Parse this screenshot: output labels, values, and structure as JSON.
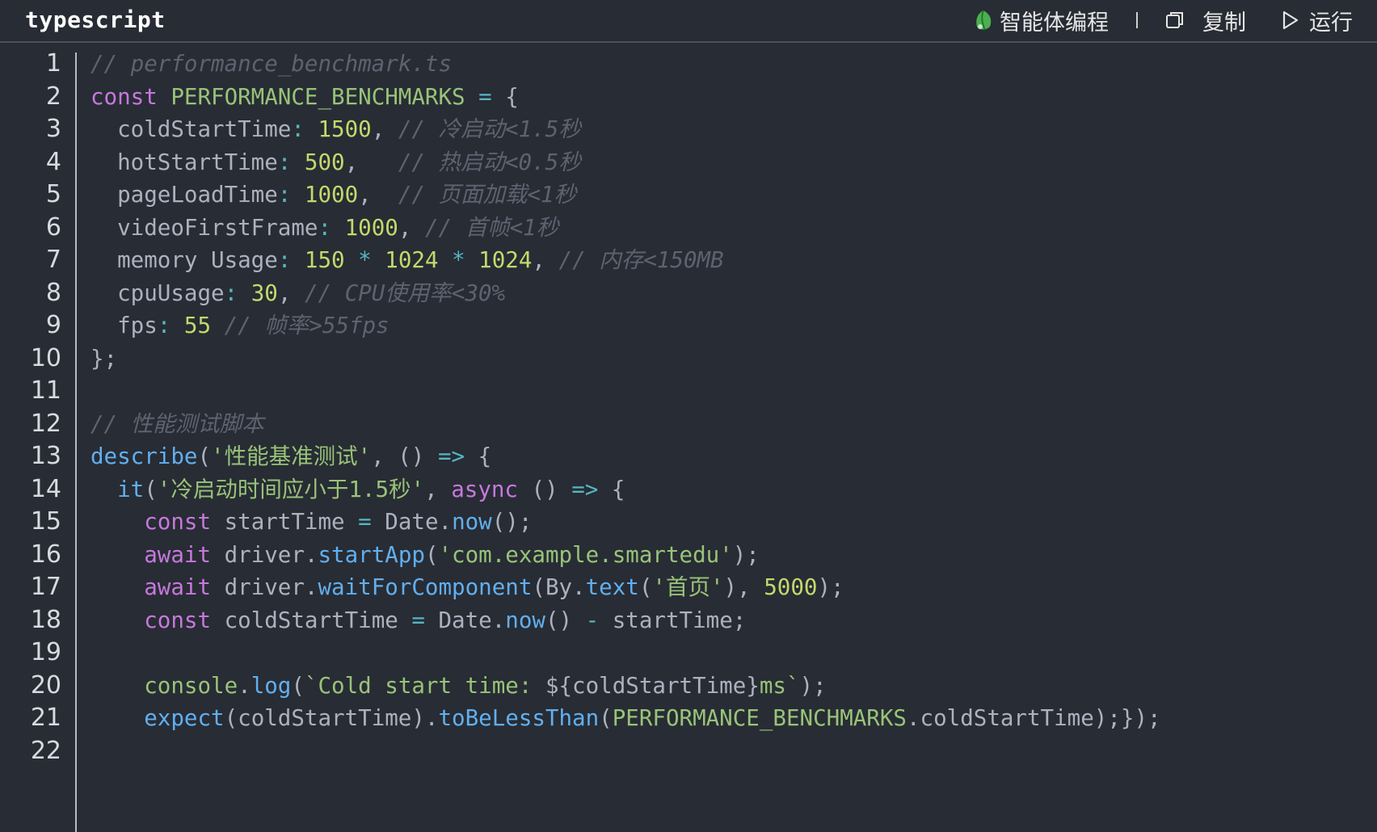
{
  "header": {
    "language": "typescript",
    "agent_label": "智能体编程",
    "copy_label": "复制",
    "run_label": "运行"
  },
  "colors": {
    "background": "#282c34",
    "keyword": "#c678dd",
    "string": "#98c379",
    "number": "#c5d86d",
    "comment": "#5c6370",
    "function": "#61afef",
    "agent_icon": "#4caf50"
  },
  "lines": [
    {
      "n": "1",
      "tokens": [
        [
          "cm",
          "// performance_benchmark.ts"
        ]
      ]
    },
    {
      "n": "2",
      "tokens": [
        [
          "kw",
          "const "
        ],
        [
          "cn",
          "PERFORMANCE_BENCHMARKS"
        ],
        [
          "op",
          " = "
        ],
        [
          "pl",
          "{"
        ]
      ]
    },
    {
      "n": "3",
      "tokens": [
        [
          "pr",
          "  coldStartTime"
        ],
        [
          "op",
          ": "
        ],
        [
          "num",
          "1500"
        ],
        [
          "pl",
          ", "
        ],
        [
          "cm",
          "// 冷启动<1.5秒"
        ]
      ]
    },
    {
      "n": "4",
      "tokens": [
        [
          "pr",
          "  hotStartTime"
        ],
        [
          "op",
          ": "
        ],
        [
          "num",
          "500"
        ],
        [
          "pl",
          ",   "
        ],
        [
          "cm",
          "// 热启动<0.5秒"
        ]
      ]
    },
    {
      "n": "5",
      "tokens": [
        [
          "pr",
          "  pageLoadTime"
        ],
        [
          "op",
          ": "
        ],
        [
          "num",
          "1000"
        ],
        [
          "pl",
          ",  "
        ],
        [
          "cm",
          "// 页面加载<1秒"
        ]
      ]
    },
    {
      "n": "6",
      "tokens": [
        [
          "pr",
          "  videoFirstFrame"
        ],
        [
          "op",
          ": "
        ],
        [
          "num",
          "1000"
        ],
        [
          "pl",
          ", "
        ],
        [
          "cm",
          "// 首帧<1秒"
        ]
      ]
    },
    {
      "n": "7",
      "tokens": [
        [
          "pr",
          "  memory Usage"
        ],
        [
          "op",
          ": "
        ],
        [
          "num",
          "150"
        ],
        [
          "op",
          " * "
        ],
        [
          "num",
          "1024"
        ],
        [
          "op",
          " * "
        ],
        [
          "num",
          "1024"
        ],
        [
          "pl",
          ", "
        ],
        [
          "cm",
          "// 内存<150MB"
        ]
      ]
    },
    {
      "n": "8",
      "tokens": [
        [
          "pr",
          "  cpuUsage"
        ],
        [
          "op",
          ": "
        ],
        [
          "num",
          "30"
        ],
        [
          "pl",
          ", "
        ],
        [
          "cm",
          "// CPU使用率<30%"
        ]
      ]
    },
    {
      "n": "9",
      "tokens": [
        [
          "pr",
          "  fps"
        ],
        [
          "op",
          ": "
        ],
        [
          "num",
          "55"
        ],
        [
          "pl",
          " "
        ],
        [
          "cm",
          "// 帧率>55fps"
        ]
      ]
    },
    {
      "n": "10",
      "tokens": [
        [
          "pl",
          "};"
        ]
      ]
    },
    {
      "n": "11",
      "tokens": []
    },
    {
      "n": "12",
      "tokens": [
        [
          "cm",
          "// 性能测试脚本"
        ]
      ]
    },
    {
      "n": "13",
      "tokens": [
        [
          "fn",
          "describe"
        ],
        [
          "pl",
          "("
        ],
        [
          "str",
          "'性能基准测试'"
        ],
        [
          "pl",
          ", () "
        ],
        [
          "op",
          "=>"
        ],
        [
          "pl",
          " {"
        ]
      ]
    },
    {
      "n": "14",
      "tokens": [
        [
          "fn",
          "  it"
        ],
        [
          "pl",
          "("
        ],
        [
          "str",
          "'冷启动时间应小于1.5秒'"
        ],
        [
          "pl",
          ", "
        ],
        [
          "kw",
          "async"
        ],
        [
          "pl",
          " () "
        ],
        [
          "op",
          "=>"
        ],
        [
          "pl",
          " {"
        ]
      ]
    },
    {
      "n": "15",
      "tokens": [
        [
          "kw",
          "    const "
        ],
        [
          "pl",
          "startTime "
        ],
        [
          "op",
          "="
        ],
        [
          "pl",
          " Date."
        ],
        [
          "fn",
          "now"
        ],
        [
          "pl",
          "();"
        ]
      ]
    },
    {
      "n": "16",
      "tokens": [
        [
          "kw",
          "    await "
        ],
        [
          "pl",
          "driver."
        ],
        [
          "fn",
          "startApp"
        ],
        [
          "pl",
          "("
        ],
        [
          "str",
          "'com.example.smartedu'"
        ],
        [
          "pl",
          ");"
        ]
      ]
    },
    {
      "n": "17",
      "tokens": [
        [
          "kw",
          "    await "
        ],
        [
          "pl",
          "driver."
        ],
        [
          "fn",
          "waitForComponent"
        ],
        [
          "pl",
          "(By."
        ],
        [
          "fn",
          "text"
        ],
        [
          "pl",
          "("
        ],
        [
          "str",
          "'首页'"
        ],
        [
          "pl",
          "), "
        ],
        [
          "num",
          "5000"
        ],
        [
          "pl",
          ");"
        ]
      ]
    },
    {
      "n": "18",
      "tokens": [
        [
          "kw",
          "    const "
        ],
        [
          "pl",
          "coldStartTime "
        ],
        [
          "op",
          "="
        ],
        [
          "pl",
          " Date."
        ],
        [
          "fn",
          "now"
        ],
        [
          "pl",
          "() "
        ],
        [
          "op",
          "-"
        ],
        [
          "pl",
          " startTime;"
        ]
      ]
    },
    {
      "n": "19",
      "tokens": []
    },
    {
      "n": "20",
      "tokens": [
        [
          "cn",
          "    console"
        ],
        [
          "pl",
          "."
        ],
        [
          "fn",
          "log"
        ],
        [
          "pl",
          "("
        ],
        [
          "str",
          "`Cold start time: "
        ],
        [
          "pl",
          "${coldStartTime}"
        ],
        [
          "str",
          "ms`"
        ],
        [
          "pl",
          ");"
        ]
      ]
    },
    {
      "n": "21",
      "tokens": [
        [
          "fn",
          "    expect"
        ],
        [
          "pl",
          "(coldStartTime)."
        ],
        [
          "fn",
          "toBeLessThan"
        ],
        [
          "pl",
          "("
        ],
        [
          "cn",
          "PERFORMANCE_BENCHMARKS"
        ],
        [
          "pl",
          ".coldStartTime);});"
        ]
      ]
    },
    {
      "n": "22",
      "tokens": []
    }
  ]
}
